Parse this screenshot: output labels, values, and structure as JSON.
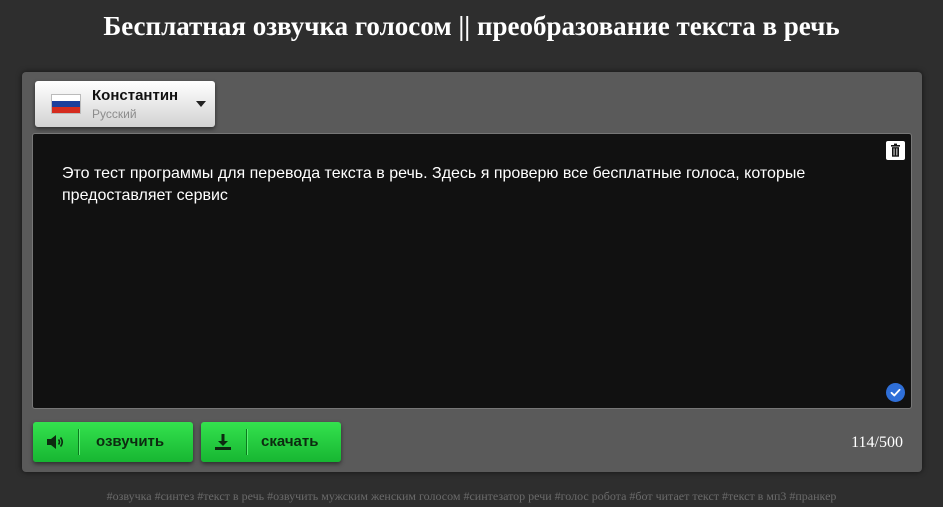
{
  "header": {
    "title": "Бесплатная озвучка голосом || преобразование текста в речь"
  },
  "voice_selector": {
    "name": "Константин",
    "language": "Русский",
    "flag_icon": "russia-flag-icon",
    "flag_colors": [
      "#ffffff",
      "#1c3f9c",
      "#d52b1e"
    ]
  },
  "editor": {
    "text": "Это тест программы для перевода текста в речь. Здесь я проверю все бесплатные голоса, которые предоставляет сервис",
    "clear_icon": "trash-icon",
    "status_icon": "check-icon",
    "status_color": "#2f6fd8"
  },
  "actions": {
    "speak_label": "озвучить",
    "speak_icon": "speaker-icon",
    "download_label": "скачать",
    "download_icon": "download-icon",
    "button_color": "#22c93d"
  },
  "counter": {
    "text": "114/500"
  },
  "footer": {
    "tags": "#озвучка #синтез #текст в речь #озвучить мужским женским голосом #синтезатор речи #голос робота #бот читает текст #текст в мп3 #пранкер"
  }
}
